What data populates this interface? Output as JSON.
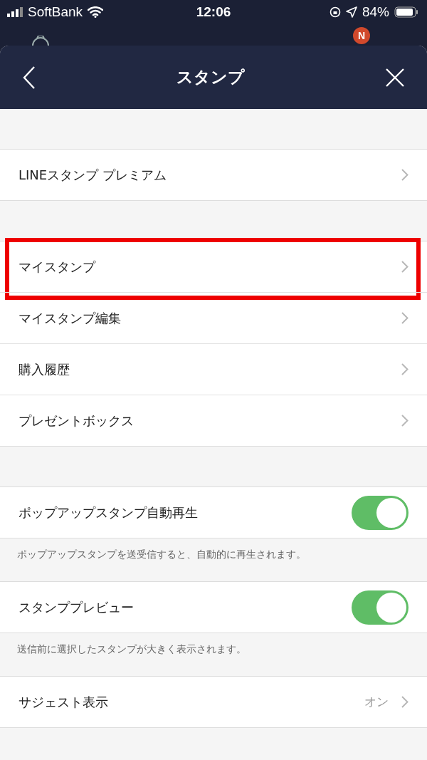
{
  "status_bar": {
    "carrier": "SoftBank",
    "time": "12:06",
    "battery": "84%"
  },
  "behind": {
    "badge": "N"
  },
  "header": {
    "title": "スタンプ"
  },
  "groups": [
    {
      "items": [
        {
          "kind": "link",
          "label": "LINEスタンプ プレミアム",
          "highlighted": false
        }
      ]
    },
    {
      "items": [
        {
          "kind": "link",
          "label": "マイスタンプ",
          "highlighted": true
        },
        {
          "kind": "link",
          "label": "マイスタンプ編集",
          "highlighted": false
        },
        {
          "kind": "link",
          "label": "購入履歴",
          "highlighted": false
        },
        {
          "kind": "link",
          "label": "プレゼントボックス",
          "highlighted": false
        }
      ]
    },
    {
      "items": [
        {
          "kind": "toggle",
          "label": "ポップアップスタンプ自動再生",
          "on": true
        }
      ],
      "note": "ポップアップスタンプを送受信すると、自動的に再生されます。"
    },
    {
      "items": [
        {
          "kind": "toggle",
          "label": "スタンププレビュー",
          "on": true
        }
      ],
      "note": "送信前に選択したスタンプが大きく表示されます。"
    },
    {
      "items": [
        {
          "kind": "value",
          "label": "サジェスト表示",
          "value": "オン"
        }
      ]
    }
  ]
}
